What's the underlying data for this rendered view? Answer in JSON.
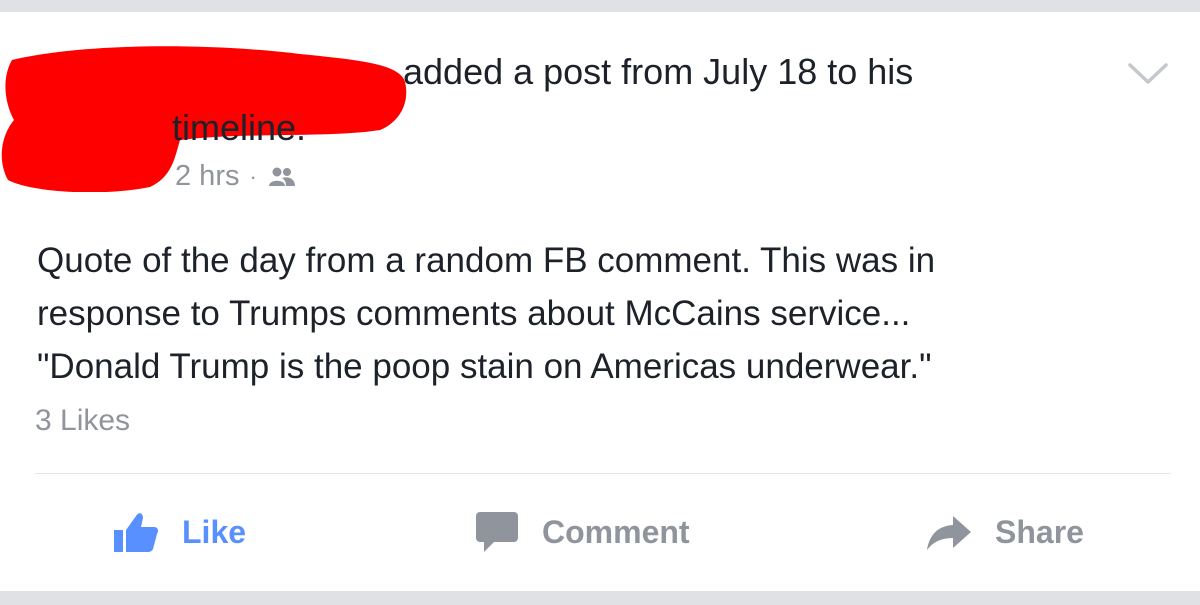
{
  "post": {
    "header_line1": "added a post from July 18 to his",
    "header_line2": "timeline.",
    "time": "2 hrs",
    "separator": "·",
    "privacy_icon": "friends-icon",
    "menu_icon": "chevron-down-icon",
    "body_lines": [
      "Quote of the day from a random FB comment. This was in",
      "response to Trumps comments about McCains service...",
      "\"Donald Trump is the poop stain on Americas underwear.\""
    ],
    "likes_count": "3 Likes"
  },
  "actions": {
    "like_label": "Like",
    "like_icon": "thumbs-up-icon",
    "comment_label": "Comment",
    "comment_icon": "speech-bubble-icon",
    "share_label": "Share",
    "share_icon": "share-arrow-icon"
  },
  "colors": {
    "background": "#dfe1e5",
    "card": "#ffffff",
    "text": "#1d2129",
    "meta": "#90949c",
    "like_accent": "#5890ff",
    "redaction": "#ff0000"
  }
}
